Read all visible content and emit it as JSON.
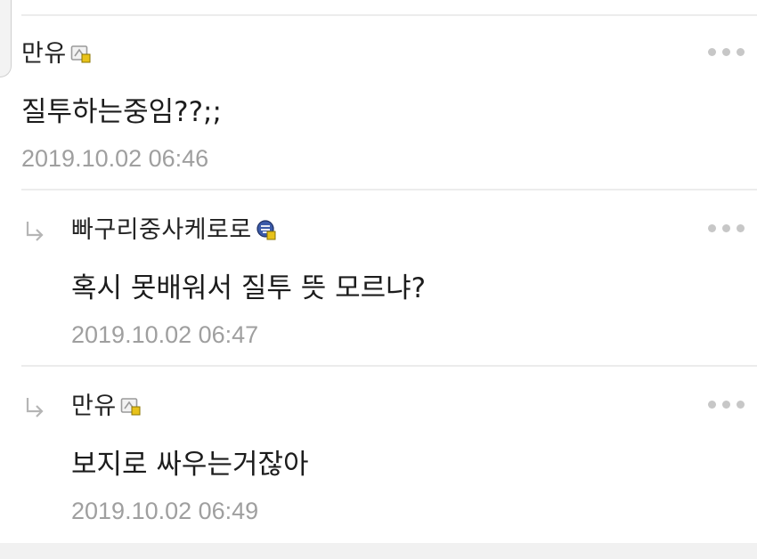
{
  "comments": [
    {
      "author": "만유",
      "badge_icon": "grade-badge-icon",
      "text": "질투하는중임??;;",
      "timestamp": "2019.10.02 06:46",
      "is_reply": false
    },
    {
      "author": "빠구리중사케로로",
      "badge_icon": "special-badge-icon",
      "text": "혹시 못배워서 질투 뜻 모르냐?",
      "timestamp": "2019.10.02 06:47",
      "is_reply": true
    },
    {
      "author": "만유",
      "badge_icon": "grade-badge-icon",
      "text": "보지로 싸우는거잖아",
      "timestamp": "2019.10.02 06:49",
      "is_reply": true
    }
  ],
  "colors": {
    "author": "#222222",
    "content": "#1c1c1c",
    "timestamp": "#9f9f9f",
    "more_dots": "#c7c7c7",
    "divider": "#ececec",
    "badge_gold": "#e8c21a"
  }
}
